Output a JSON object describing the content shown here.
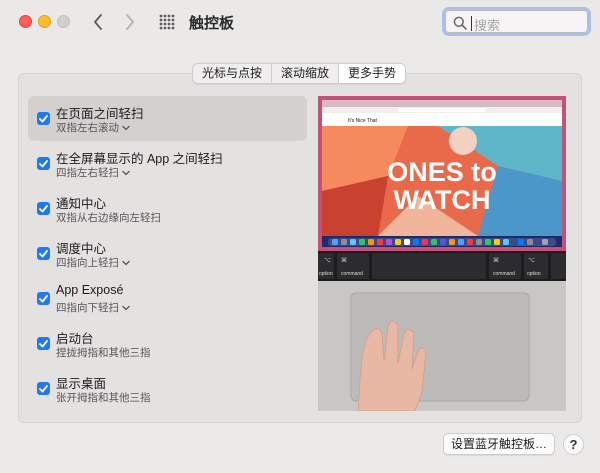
{
  "window": {
    "title": "触控板"
  },
  "search": {
    "placeholder": "搜索"
  },
  "tabs": [
    {
      "label": "光标与点按",
      "active": false
    },
    {
      "label": "滚动缩放",
      "active": false
    },
    {
      "label": "更多手势",
      "active": true
    }
  ],
  "gestures": [
    {
      "title": "在页面之间轻扫",
      "subtitle": "双指左右滚动",
      "checked": true,
      "has_dropdown": true,
      "selected": true
    },
    {
      "title": "在全屏幕显示的 App 之间轻扫",
      "subtitle": "四指左右轻扫",
      "checked": true,
      "has_dropdown": true,
      "selected": false
    },
    {
      "title": "通知中心",
      "subtitle": "双指从右边缘向左轻扫",
      "checked": true,
      "has_dropdown": false,
      "selected": false
    },
    {
      "title": "调度中心",
      "subtitle": "四指向上轻扫",
      "checked": true,
      "has_dropdown": true,
      "selected": false
    },
    {
      "title": "App Exposé",
      "subtitle": "四指向下轻扫",
      "checked": true,
      "has_dropdown": true,
      "selected": false
    },
    {
      "title": "启动台",
      "subtitle": "捏拢拇指和其他三指",
      "checked": true,
      "has_dropdown": false,
      "selected": false
    },
    {
      "title": "显示桌面",
      "subtitle": "张开拇指和其他三指",
      "checked": true,
      "has_dropdown": false,
      "selected": false
    }
  ],
  "preview": {
    "site_name": "It's Nice That",
    "headline_line1": "ONES to",
    "headline_line2": "WATCH",
    "keys": {
      "command_left": "command",
      "option_left": "option",
      "command_right": "command",
      "option_right": "option",
      "cmd_symbol": "⌘",
      "opt_symbol": "⌥"
    }
  },
  "footer": {
    "bluetooth_button": "设置蓝牙触控板…",
    "help_button": "?"
  },
  "colors": {
    "accent": "#1f79f2",
    "search_focus": "#a9bff0"
  }
}
